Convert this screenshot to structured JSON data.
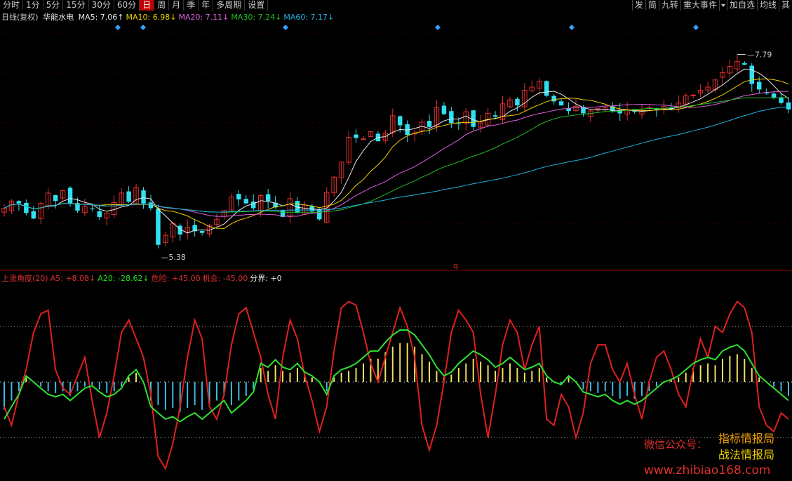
{
  "toolbar": {
    "items": [
      "分时",
      "1分",
      "5分",
      "15分",
      "30分",
      "60分",
      "日",
      "周",
      "月",
      "季",
      "年",
      "多周期",
      "设置"
    ],
    "active_index": 6
  },
  "toolbar_right": {
    "items": [
      "发",
      "简",
      "九转",
      "重大事件"
    ],
    "items2": [
      "加自选",
      "均线",
      "其"
    ]
  },
  "main_legend": {
    "period": "日线(复权)",
    "stock_name": "华能水电",
    "ma": [
      {
        "label": "MA5: 7.06",
        "arrow": "↑",
        "color": "#e8e8e8"
      },
      {
        "label": "MA10: 6.98",
        "arrow": "↓",
        "color": "#f0d000"
      },
      {
        "label": "MA20: 7.11",
        "arrow": "↓",
        "color": "#e060e0"
      },
      {
        "label": "MA30: 7.24",
        "arrow": "↓",
        "color": "#20c020"
      },
      {
        "label": "MA60: 7.17",
        "arrow": "↓",
        "color": "#20b0e0"
      }
    ]
  },
  "price_labels": {
    "high": "7.79",
    "low": "5.38",
    "marker": "q"
  },
  "indicator_legend": {
    "items": [
      {
        "label": "上涨角度(20)",
        "arrow": "",
        "color": "#e03030"
      },
      {
        "label": "A5: +8.08",
        "arrow": "↓",
        "color": "#e03030"
      },
      {
        "label": "A20: -28.62",
        "arrow": "↓",
        "color": "#20e020"
      },
      {
        "label": "危险: +45.00",
        "arrow": "",
        "color": "#e03030"
      },
      {
        "label": "机会: -45.00",
        "arrow": "",
        "color": "#e03030"
      },
      {
        "label": "分界: +0",
        "arrow": "",
        "color": "#e8e8e8"
      }
    ]
  },
  "watermark": {
    "line1_left": "微信公众号：",
    "line1_right": "指标情报局",
    "line2_right": "战法情报局",
    "url": "www.zhibiao168.com"
  },
  "chart_data": {
    "type": "candlestick",
    "price_range": [
      5.38,
      7.79
    ],
    "price_high": 7.79,
    "price_low": 5.38,
    "moving_averages": {
      "MA5": 7.06,
      "MA10": 6.98,
      "MA20": 7.11,
      "MA30": 7.24,
      "MA60": 7.17
    },
    "indicator": {
      "name": "上涨角度(20)",
      "A5": 8.08,
      "A20": -28.62,
      "danger": 45.0,
      "opportunity": -45.0,
      "divider": 0,
      "ylim": [
        -80,
        80
      ]
    },
    "close_series": [
      5.86,
      5.95,
      5.92,
      5.8,
      5.73,
      5.92,
      6.05,
      5.95,
      6.08,
      5.92,
      5.83,
      5.88,
      5.85,
      5.75,
      5.8,
      5.93,
      6.05,
      5.94,
      6.12,
      5.92,
      5.86,
      5.4,
      5.52,
      5.67,
      5.53,
      5.62,
      5.57,
      5.55,
      5.64,
      5.72,
      5.83,
      6.0,
      5.97,
      5.92,
      5.86,
      6.02,
      5.95,
      5.87,
      5.75,
      5.98,
      5.8,
      5.9,
      5.82,
      5.72,
      6.06,
      6.25,
      6.44,
      6.75,
      6.74,
      6.73,
      6.82,
      6.7,
      6.8,
      7.02,
      6.9,
      6.78,
      6.8,
      6.94,
      6.88,
      7.12,
      7.04,
      6.93,
      6.92,
      7.07,
      6.88,
      6.93,
      7.05,
      7.01,
      7.17,
      7.22,
      7.15,
      7.34,
      7.38,
      7.45,
      7.27,
      7.2,
      7.15,
      7.08,
      7.14,
      7.05,
      7.08,
      7.11,
      7.12,
      7.08,
      7.05,
      7.1,
      7.07,
      7.08,
      7.12,
      7.1,
      7.14,
      7.1,
      7.18,
      7.27,
      7.28,
      7.34,
      7.38,
      7.47,
      7.56,
      7.64,
      7.7,
      7.66,
      7.42,
      7.35,
      7.3,
      7.25,
      7.18,
      7.1
    ],
    "A5_series": [
      -20,
      -35,
      -10,
      10,
      40,
      55,
      58,
      10,
      -5,
      -10,
      5,
      20,
      -15,
      -45,
      -25,
      5,
      40,
      50,
      35,
      20,
      -10,
      -60,
      -70,
      -50,
      -20,
      20,
      50,
      35,
      -20,
      -30,
      -10,
      30,
      55,
      60,
      40,
      20,
      -10,
      -30,
      20,
      50,
      35,
      5,
      -15,
      -40,
      -20,
      25,
      60,
      65,
      62,
      40,
      15,
      0,
      20,
      40,
      60,
      45,
      20,
      -35,
      -55,
      -35,
      0,
      40,
      58,
      50,
      40,
      -10,
      -45,
      -10,
      30,
      50,
      40,
      10,
      30,
      45,
      -30,
      -35,
      -10,
      -20,
      -45,
      -25,
      15,
      30,
      30,
      10,
      0,
      15,
      -10,
      -30,
      0,
      20,
      25,
      10,
      -10,
      -20,
      10,
      35,
      20,
      45,
      40,
      55,
      65,
      60,
      40,
      -20,
      -35,
      -40,
      -25,
      -30
    ],
    "A20_series": [
      -30,
      -20,
      -10,
      5,
      0,
      -5,
      -10,
      -12,
      -10,
      -15,
      -10,
      -5,
      -3,
      -8,
      -12,
      -10,
      -5,
      5,
      10,
      0,
      -20,
      -25,
      -30,
      -28,
      -32,
      -28,
      -25,
      -30,
      -25,
      -20,
      -15,
      -25,
      -20,
      -15,
      -8,
      15,
      12,
      18,
      12,
      10,
      15,
      8,
      5,
      0,
      -10,
      5,
      10,
      12,
      15,
      20,
      25,
      25,
      32,
      38,
      42,
      42,
      38,
      30,
      22,
      12,
      5,
      8,
      15,
      20,
      25,
      22,
      18,
      12,
      15,
      20,
      15,
      10,
      12,
      15,
      5,
      0,
      -2,
      5,
      0,
      -8,
      -10,
      -12,
      -10,
      -15,
      -18,
      -15,
      -18,
      -15,
      -10,
      -5,
      0,
      2,
      5,
      10,
      15,
      18,
      20,
      18,
      25,
      28,
      30,
      25,
      15,
      5,
      0,
      -5,
      -10,
      -15
    ]
  }
}
